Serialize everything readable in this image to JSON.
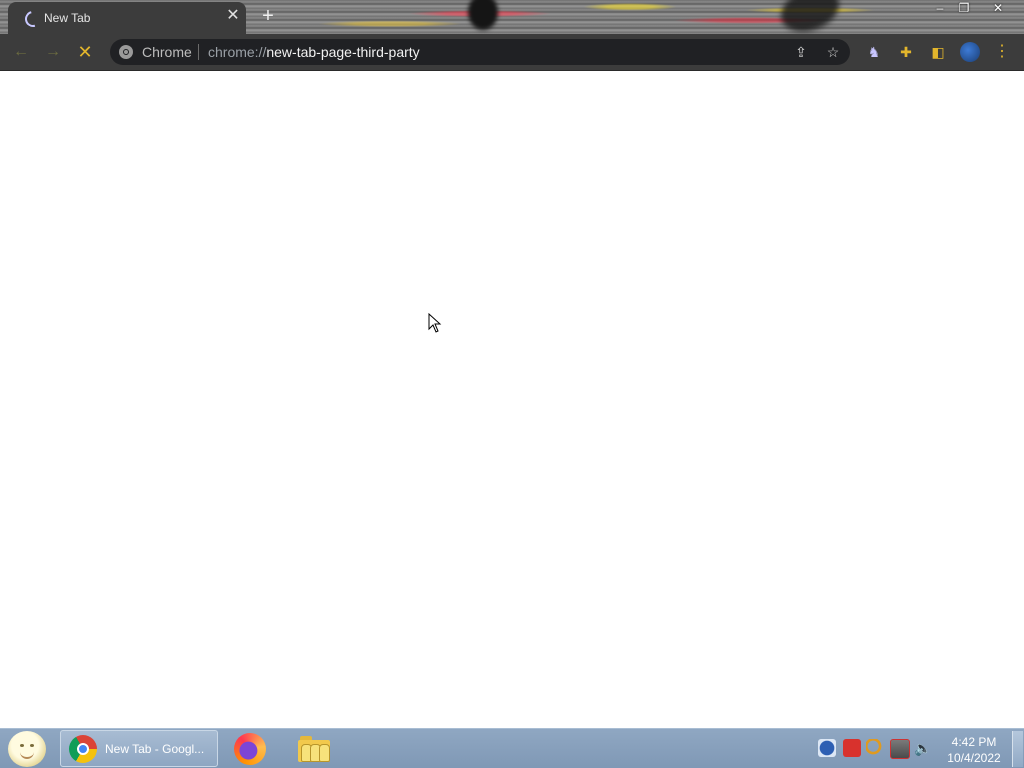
{
  "browser": {
    "tab": {
      "title": "New Tab"
    },
    "omnibox": {
      "chip_label": "Chrome",
      "url_scheme": "chrome://",
      "url_host": "new-tab-page-third-party"
    }
  },
  "taskbar": {
    "active_task_label": "New Tab - Googl...",
    "clock": {
      "time": "4:42 PM",
      "date": "10/4/2022"
    }
  },
  "colors": {
    "toolbar": "#3c3c3c",
    "omnibox": "#202124",
    "taskbar": "#8fa7c2"
  }
}
